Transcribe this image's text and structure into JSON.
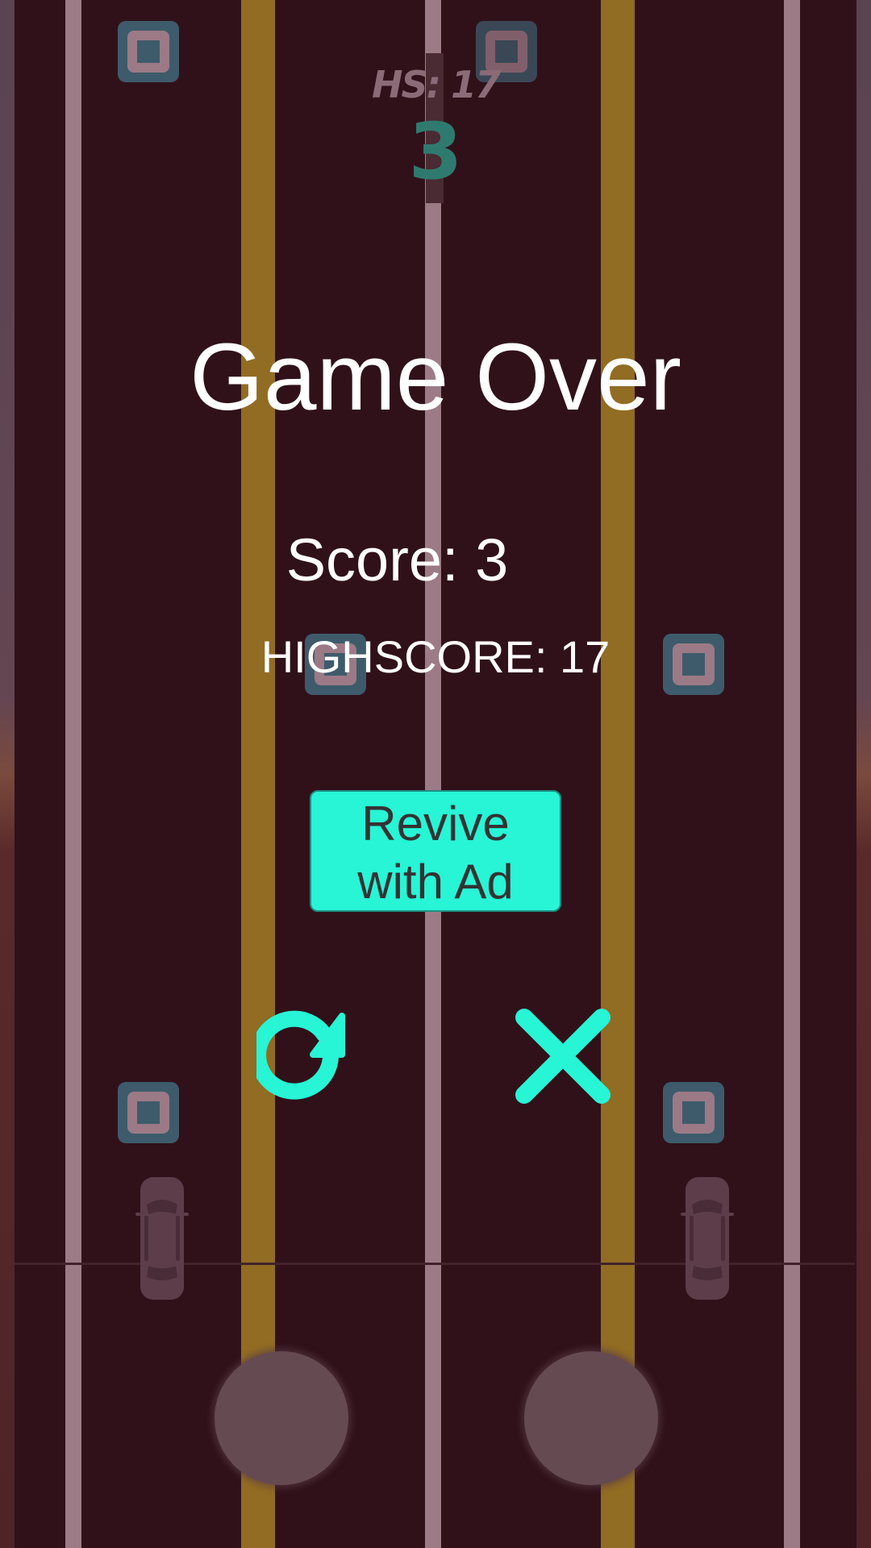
{
  "hud": {
    "highscore_label": "HS: 17",
    "score_value": "3"
  },
  "game_over": {
    "title": "Game Over",
    "score_text": "Score: 3",
    "highscore_text": "HIGHSCORE: 17",
    "revive_line1": "Revive",
    "revive_line2": "with Ad"
  },
  "icons": {
    "restart": "restart-icon",
    "close": "close-icon",
    "car": "car-icon",
    "obstacle": "obstacle-block-icon"
  },
  "colors": {
    "background": "#30111a",
    "accent": "#27f5d6",
    "lane_white": "#9c7b86",
    "lane_yellow": "#916c23",
    "hud_score": "#2f7a6e"
  }
}
